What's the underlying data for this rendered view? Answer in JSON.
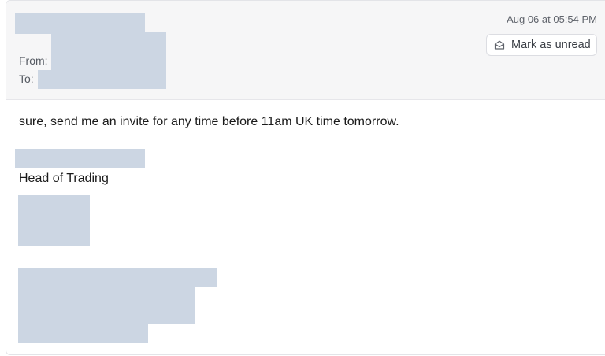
{
  "header": {
    "from_label": "From:",
    "to_label": "To:",
    "timestamp": "Aug 06 at 05:54 PM",
    "mark_unread_label": "Mark as unread",
    "mark_unread_icon": "envelope-open-icon"
  },
  "message": {
    "body": "sure, send me an invite for any time before 11am UK time tomorrow.",
    "signature_title": "Head of Trading"
  },
  "colors": {
    "redaction": "#ccd6e3",
    "header_bg": "#f6f6f7"
  }
}
